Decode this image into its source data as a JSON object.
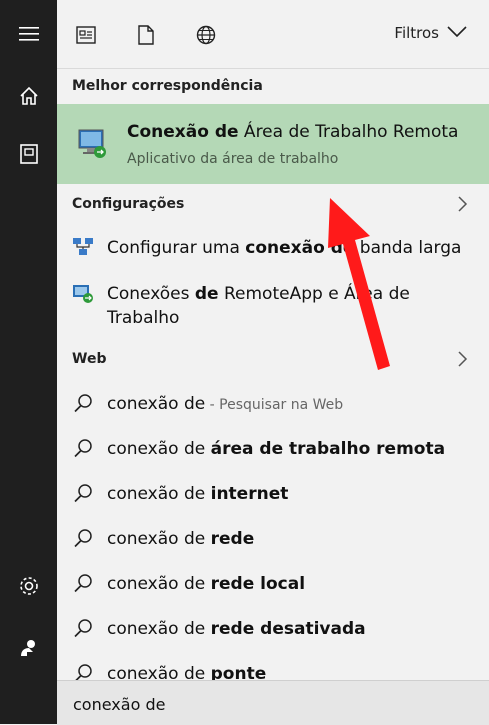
{
  "sidebar": {
    "icons": [
      "hamburger-icon",
      "home-icon",
      "notebook-icon",
      "gear-icon",
      "feedback-icon"
    ]
  },
  "toolbar": {
    "filters_label": "Filtros"
  },
  "best_match": {
    "section_label": "Melhor correspondência",
    "title_bold": "Conexão de",
    "title_rest": " Área de Trabalho Remota",
    "subtitle": "Aplicativo da área de trabalho"
  },
  "settings": {
    "section_label": "Configurações",
    "items": [
      {
        "prefix": "Configurar uma ",
        "bold": "conexão de",
        "suffix": " banda larga"
      },
      {
        "prefix": "Conexões ",
        "bold": "de",
        "suffix": " RemoteApp e Área de Trabalho"
      }
    ]
  },
  "web": {
    "section_label": "Web",
    "first": {
      "text": "conexão de",
      "hint": " - Pesquisar na Web"
    },
    "items": [
      {
        "prefix": "conexão de ",
        "bold": "área de trabalho remota"
      },
      {
        "prefix": "conexão de ",
        "bold": "internet"
      },
      {
        "prefix": "conexão de ",
        "bold": "rede"
      },
      {
        "prefix": "conexão de ",
        "bold": "rede local"
      },
      {
        "prefix": "conexão de ",
        "bold": "rede desativada"
      },
      {
        "prefix": "conexão de ",
        "bold": "ponte"
      }
    ]
  },
  "search": {
    "value": "conexão de"
  },
  "colors": {
    "best_match_bg": "#b4d8b6",
    "arrow": "#ff1a1a",
    "rail_bg": "#1f1f1f"
  }
}
